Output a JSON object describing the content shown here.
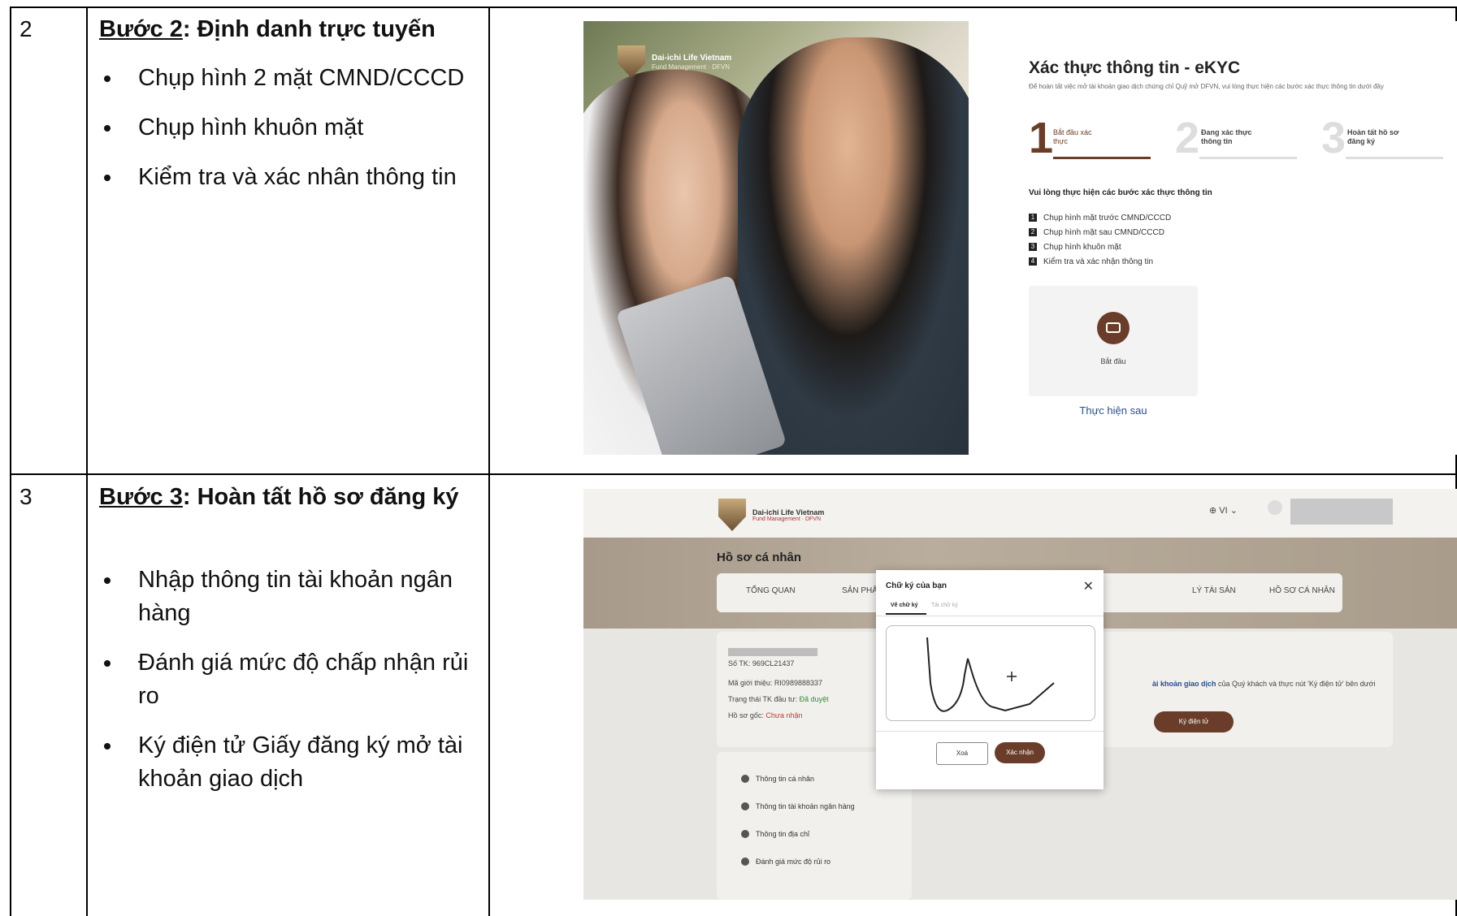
{
  "rows": [
    {
      "number": "2",
      "step_label": "Bước 2",
      "step_title": ": Định danh trực tuyến",
      "bullets": [
        "Chụp hình 2 mặt CMND/CCCD",
        "Chụp hình khuôn mặt",
        "Kiểm tra và xác nhân thông tin"
      ]
    },
    {
      "number": "3",
      "step_label": "Bước 3",
      "step_title": ": Hoàn tất hồ sơ đăng ký",
      "bullets": [
        "Nhập thông tin tài khoản ngân hàng",
        "Đánh giá mức độ chấp nhận rủi ro",
        "Ký điện tử Giấy đăng ký mở tài khoản giao dịch"
      ]
    }
  ],
  "screen1": {
    "logo_title": "Dai-ichi Life Vietnam",
    "logo_sub": "Fund Management · DFVN",
    "title": "Xác thực thông tin - eKYC",
    "subtitle": "Để hoàn tất việc mở tài khoản giao dịch chứng chỉ Quỹ mở DFVN, vui lòng thực hiện các bước xác thực thông tin dưới đây",
    "steps": [
      {
        "num": "1",
        "label": "Bắt đầu xác thực"
      },
      {
        "num": "2",
        "label": "Đang xác thực thông tin"
      },
      {
        "num": "3",
        "label": "Hoàn tất hồ sơ đăng ký"
      }
    ],
    "instruction": "Vui lòng thực hiện các bước xác thực thông tin",
    "items": [
      "Chụp hình mặt trước CMND/CCCD",
      "Chụp hình mặt sau CMND/CCCD",
      "Chụp hình khuôn mặt",
      "Kiểm tra và xác nhận thông tin"
    ],
    "start_label": "Bắt đầu",
    "later_link": "Thực hiện sau"
  },
  "screen2": {
    "logo_title": "Dai-ichi Life Vietnam",
    "logo_sub": "Fund Management · DFVN",
    "lang": "⊕ VI ⌄",
    "page_title": "Hồ sơ cá nhân",
    "tabs": [
      "TỔNG QUAN",
      "SẢN PHẨM",
      "LÝ TÀI SẢN",
      "HỒ SƠ CÁ NHÂN"
    ],
    "account_no": "Số TK: 969CL21437",
    "referral": "Mã giới thiệu: RI0989888337",
    "status_label": "Trạng thái TK đầu tư: ",
    "status_value": "Đã duyệt",
    "origin_label": "Hồ sơ gốc: ",
    "origin_value": "Chưa nhận",
    "right_text_bold": "ài khoản giao dịch",
    "right_text": " của Quý khách và thực nút 'Ký điện tử' bên dưới",
    "sign_button": "Ký điện tử",
    "checklist": [
      "Thông tin cá nhân",
      "Thông tin tài khoản ngân hàng",
      "Thông tin địa chỉ",
      "Đánh giá mức độ rủi ro"
    ],
    "modal": {
      "title": "Chữ ký của bạn",
      "tab_draw": "Vẽ chữ ký",
      "tab_upload": "Tải chữ ký",
      "delete": "Xoá",
      "confirm": "Xác nhận"
    }
  }
}
